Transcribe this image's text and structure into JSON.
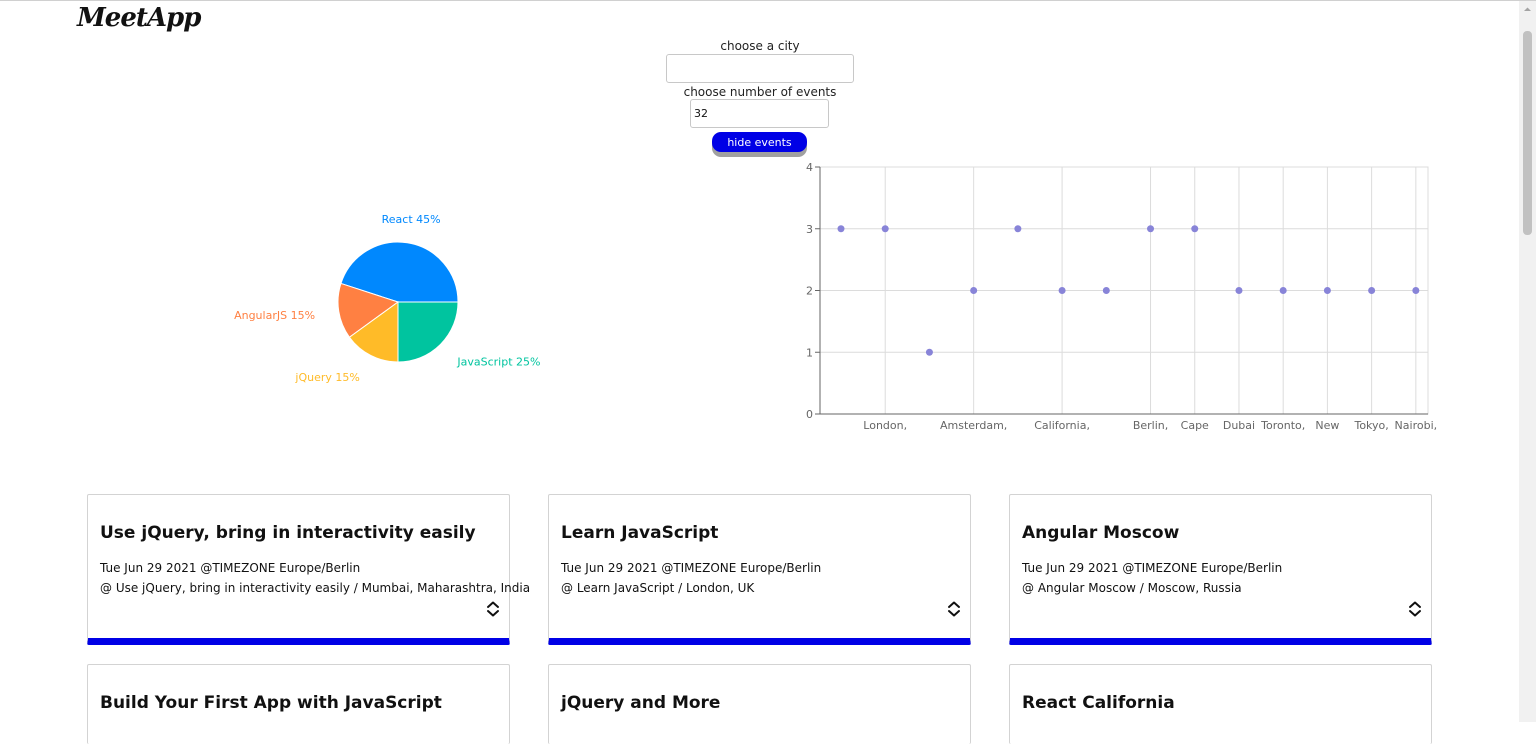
{
  "app": {
    "title": "MeetApp"
  },
  "search": {
    "label": "choose a city",
    "value": "",
    "placeholder": ""
  },
  "number_of_events": {
    "label": "choose number of events",
    "value": "32"
  },
  "toggle_button": {
    "label": "hide events"
  },
  "colors": {
    "accent": "#0000e6",
    "scatter_point": "#8884d8",
    "border": "#d3d3d3"
  },
  "chart_data": [
    {
      "type": "pie",
      "categories": [
        "React",
        "AngularJS",
        "jQuery",
        "JavaScript"
      ],
      "values": [
        45,
        15,
        15,
        25
      ],
      "labels": [
        "React 45%",
        "AngularJS 15%",
        "jQuery 15%",
        "JavaScript 25%"
      ],
      "colors": [
        "#0088FE",
        "#FF8042",
        "#FFBB28",
        "#00C49F"
      ]
    },
    {
      "type": "scatter",
      "x": [
        "",
        "London,",
        "",
        "Amsterdam,",
        "",
        "California,",
        "",
        "Berlin,",
        "Cape",
        "Dubai",
        "Toronto,",
        "New",
        "Tokyo,",
        "Nairobi,"
      ],
      "y": [
        3,
        3,
        1,
        2,
        3,
        2,
        2,
        3,
        3,
        2,
        2,
        2,
        2,
        2
      ],
      "xtick_labels": [
        "London,",
        "Amsterdam,",
        "California,",
        "Berlin,",
        "Cape",
        "Dubai",
        "Toronto,",
        "New",
        "Tokyo,",
        "Nairobi,"
      ],
      "ylim": [
        0,
        4
      ],
      "yticks": [
        "0",
        "1",
        "2",
        "3",
        "4"
      ],
      "grid": true
    }
  ],
  "events": [
    {
      "title": "Use jQuery, bring in interactivity easily",
      "date": "Tue Jun 29 2021 @TIMEZONE Europe/Berlin",
      "location": "@ Use jQuery, bring in interactivity easily / Mumbai, Maharashtra, India"
    },
    {
      "title": "Learn JavaScript",
      "date": "Tue Jun 29 2021 @TIMEZONE Europe/Berlin",
      "location": "@ Learn JavaScript / London, UK"
    },
    {
      "title": "Angular Moscow",
      "date": "Tue Jun 29 2021 @TIMEZONE Europe/Berlin",
      "location": "@ Angular Moscow / Moscow, Russia"
    },
    {
      "title": "Build Your First App with JavaScript"
    },
    {
      "title": "jQuery and More"
    },
    {
      "title": "React California"
    }
  ]
}
